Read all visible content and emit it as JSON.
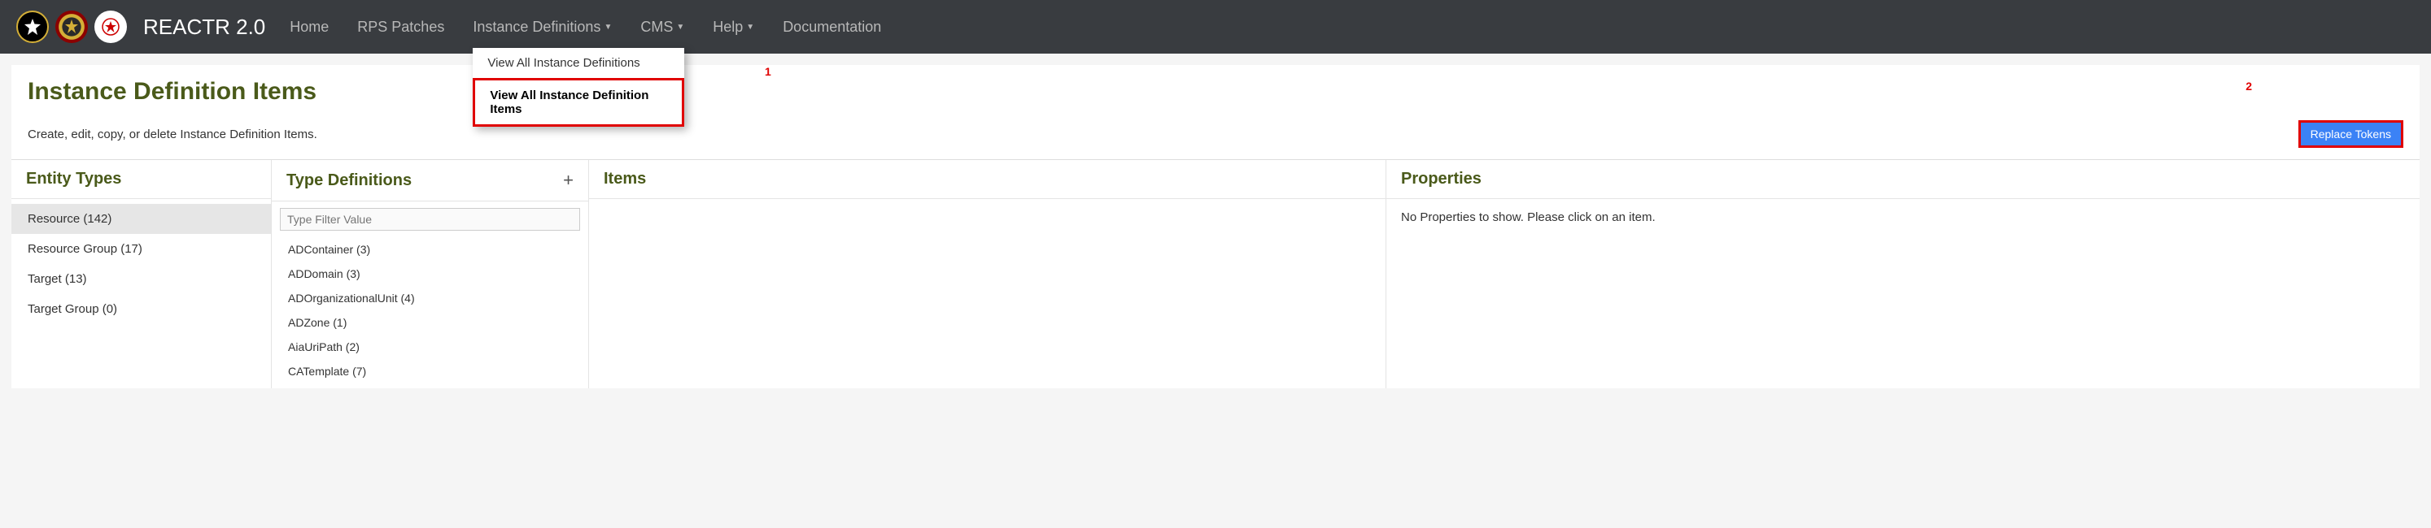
{
  "app_title": "REACTR 2.0",
  "nav": {
    "home": "Home",
    "rps": "RPS Patches",
    "instance_defs": "Instance Definitions",
    "cms": "CMS",
    "help": "Help",
    "docs": "Documentation"
  },
  "dropdown": {
    "view_all_defs": "View All Instance Definitions",
    "view_all_items": "View All Instance Definition Items"
  },
  "annotations": {
    "a1": "1",
    "a2": "2"
  },
  "page": {
    "title": "Instance Definition Items",
    "subtitle": "Create, edit, copy, or delete Instance Definition Items.",
    "replace_tokens": "Replace Tokens"
  },
  "panels": {
    "entity": {
      "title": "Entity Types",
      "items": [
        {
          "label": "Resource (142)",
          "selected": true
        },
        {
          "label": "Resource Group (17)",
          "selected": false
        },
        {
          "label": "Target (13)",
          "selected": false
        },
        {
          "label": "Target Group (0)",
          "selected": false
        }
      ]
    },
    "typedef": {
      "title": "Type Definitions",
      "filter_placeholder": "Type Filter Value",
      "items": [
        "ADContainer (3)",
        "ADDomain (3)",
        "ADOrganizationalUnit (4)",
        "ADZone (1)",
        "AiaUriPath (2)",
        "CATemplate (7)"
      ]
    },
    "items": {
      "title": "Items"
    },
    "props": {
      "title": "Properties",
      "empty": "No Properties to show. Please click on an item."
    }
  }
}
